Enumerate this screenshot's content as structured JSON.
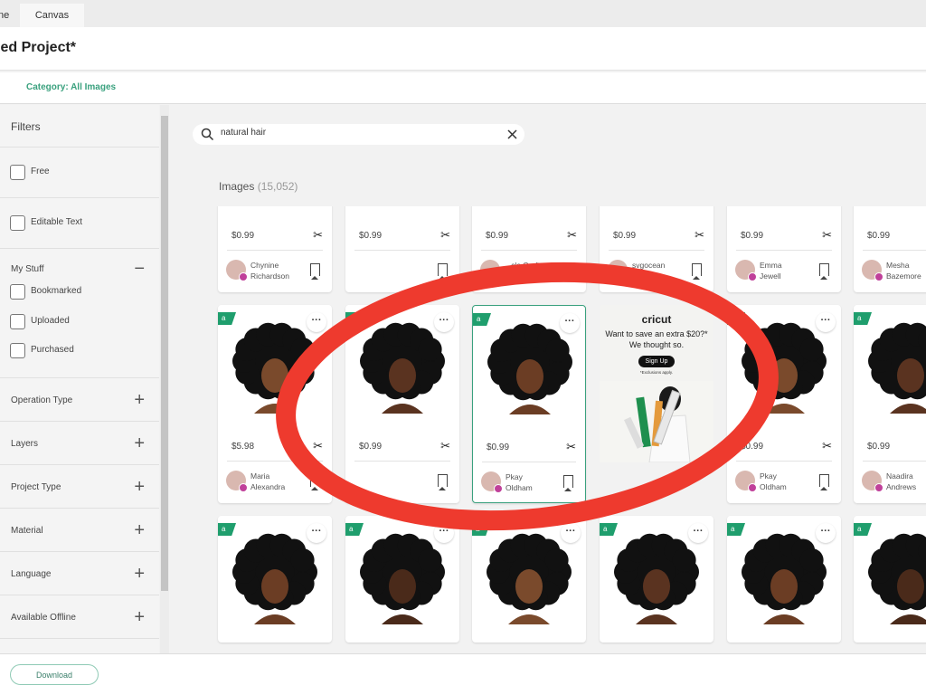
{
  "tabs": [
    {
      "label": "ne"
    },
    {
      "label": "Canvas"
    }
  ],
  "project_title": "led Project*",
  "category": "Category: All Images",
  "sidebar": {
    "title": "Filters",
    "free": "Free",
    "editable": "Editable Text",
    "my_stuff": "My Stuff",
    "my_stuff_items": [
      "Bookmarked",
      "Uploaded",
      "Purchased"
    ],
    "sections": [
      "Operation Type",
      "Layers",
      "Project Type",
      "Material",
      "Language",
      "Available Offline"
    ]
  },
  "search": {
    "value": "natural hair"
  },
  "results": {
    "label": "Images",
    "count": "(15,052)"
  },
  "rows": [
    [
      {
        "price": "$0.99",
        "author": [
          "Chynine",
          "Richardson"
        ]
      },
      {
        "price": "$0.99",
        "author": []
      },
      {
        "price": "$0.99",
        "author": [
          "...cle Craft"
        ]
      },
      {
        "price": "$0.99",
        "author": [
          "svgocean"
        ]
      },
      {
        "price": "$0.99",
        "author": [
          "Emma",
          "Jewell"
        ]
      },
      {
        "price": "$0.99",
        "author": [
          "Mesha",
          "Bazemore"
        ]
      }
    ],
    [
      {
        "price": "$5.98",
        "author": [
          "Maria",
          "Alexandra"
        ]
      },
      {
        "price": "$0.99",
        "author": []
      },
      {
        "price": "$0.99",
        "author": [
          "Pkay",
          "Oldham"
        ],
        "selected": true
      },
      null,
      {
        "price": "$0.99",
        "author": [
          "Pkay",
          "Oldham"
        ]
      },
      {
        "price": "$0.99",
        "author": [
          "Naadira",
          "Andrews"
        ]
      }
    ],
    [
      {},
      {},
      {},
      {},
      {},
      {}
    ]
  ],
  "ad": {
    "brand": "cricut",
    "message": "Want to save an extra $20?* We thought so.",
    "button": "Sign Up",
    "fine": "*Exclusions apply."
  },
  "footer": {
    "download": "Download"
  },
  "colors": {
    "accent": "#3aa17e",
    "annotation": "#ee3a2e"
  }
}
